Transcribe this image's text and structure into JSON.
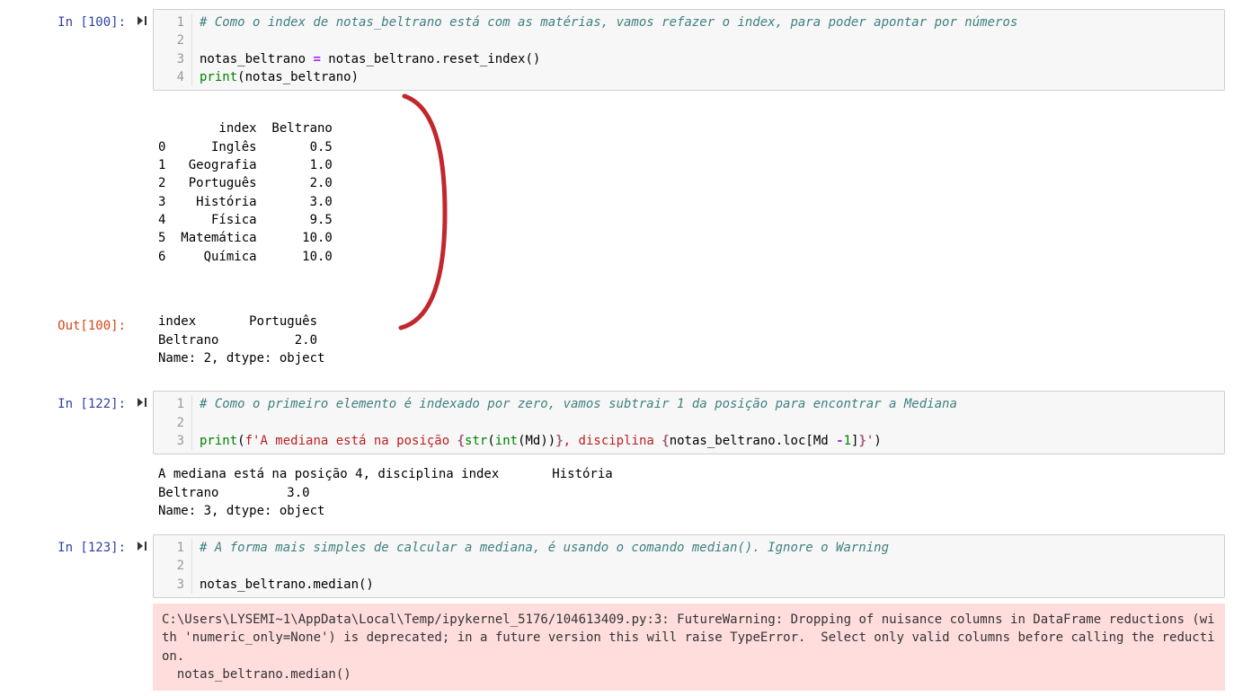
{
  "cells": [
    {
      "prompt_in": "In [100]:",
      "code": {
        "l1_comment": "# Como o index de notas_beltrano está com as matérias, vamos refazer o index, para poder apontar por números",
        "l2": "",
        "l3_p1": "notas_beltrano ",
        "l3_op": "=",
        "l3_p2": " notas_beltrano.reset_index()",
        "l4_fn": "print",
        "l4_p2": "(notas_beltrano)"
      },
      "stdout": "        index  Beltrano\n0      Inglês       0.5\n1   Geografia       1.0\n2   Português       2.0\n3    História       3.0\n4      Física       9.5\n5  Matemática      10.0\n6     Química      10.0",
      "prompt_out": "Out[100]:",
      "out_text": "index       Português\nBeltrano          2.0\nName: 2, dtype: object"
    },
    {
      "prompt_in": "In [122]:",
      "code": {
        "l1_comment": "# Como o primeiro elemento é indexado por zero, vamos subtrair 1 da posição para encontrar a Mediana",
        "l2": "",
        "l3_fn": "print",
        "l3_p1": "(",
        "l3_s1": "f'A mediana está na posição ",
        "l3_ib1": "{",
        "l3_fn2": "str",
        "l3_p2": "(",
        "l3_fn3": "int",
        "l3_p3": "(Md))",
        "l3_ib2": "}",
        "l3_s2": ", disciplina ",
        "l3_ib3": "{",
        "l3_p4": "notas_beltrano.loc[Md ",
        "l3_op": "-",
        "l3_num": "1",
        "l3_p5": "]",
        "l3_ib4": "}",
        "l3_s3": "'",
        "l3_p6": ")"
      },
      "stdout": "A mediana está na posição 4, disciplina index       História\nBeltrano         3.0\nName: 3, dtype: object"
    },
    {
      "prompt_in": "In [123]:",
      "code": {
        "l1_comment": "# A forma mais simples de calcular a mediana, é usando o comando median(). Ignore o Warning",
        "l2": "",
        "l3": "notas_beltrano.median()"
      },
      "warning": "C:\\Users\\LYSEMI~1\\AppData\\Local\\Temp/ipykernel_5176/104613409.py:3: FutureWarning: Dropping of nuisance columns in DataFrame reductions (with 'numeric_only=None') is deprecated; in a future version this will raise TypeError.  Select only valid columns before calling the reduction.\n  notas_beltrano.median()"
    }
  ],
  "run_icon": "▸|"
}
